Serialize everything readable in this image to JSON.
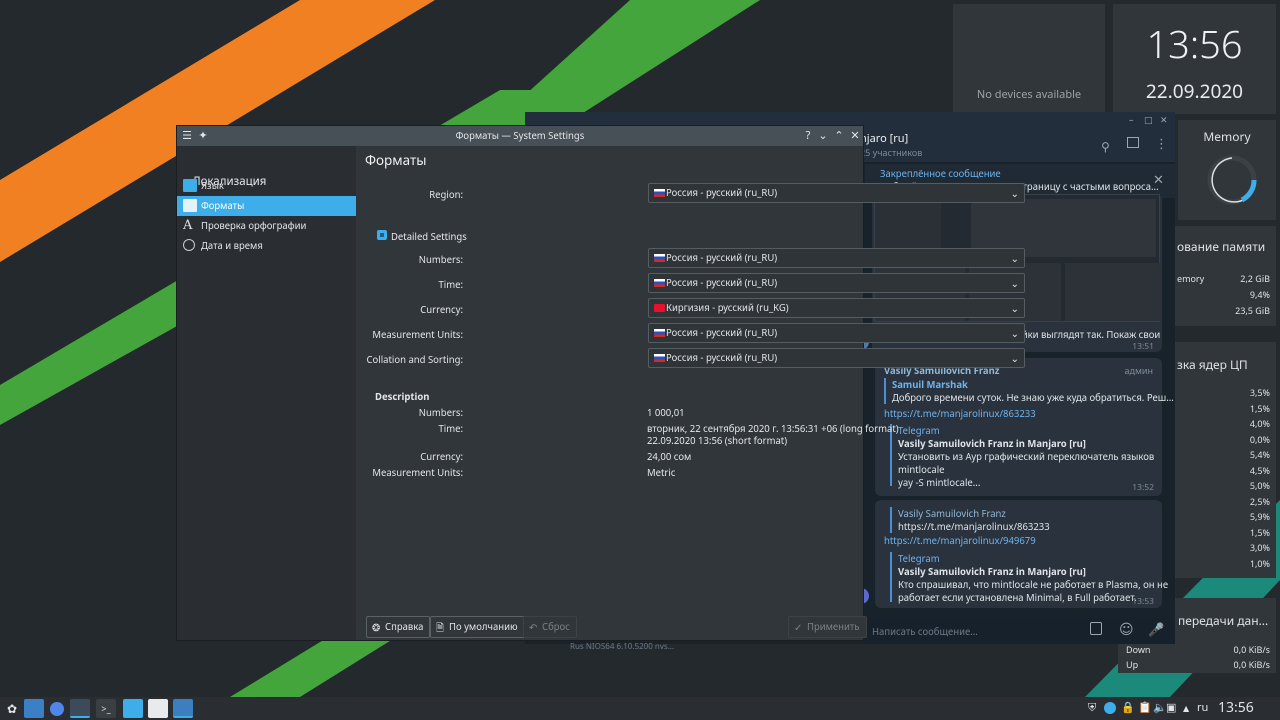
{
  "desktop": {
    "devices_text": "No devices available",
    "clock_time": "13:56",
    "clock_date": "22.09.2020",
    "memory_title": "Memory",
    "usage_title": "ование памяти",
    "usage_rows": [
      {
        "label": "emory",
        "value": "2,2 GiB"
      },
      {
        "label": "",
        "value": "9,4%"
      },
      {
        "label": "",
        "value": "23,5 GiB"
      }
    ],
    "cpu_title": "зка ядер ЦП",
    "cpu_values": [
      "3,5%",
      "1,5%",
      "4,0%",
      "0,0%",
      "5,4%",
      "4,5%",
      "5,0%",
      "2,5%",
      "5,9%",
      "1,5%",
      "3,0%",
      "1,0%"
    ],
    "net_title": "передачи дан...",
    "net_rows": [
      {
        "label": "Down",
        "value": "0,0 KiB/s"
      },
      {
        "label": "Up",
        "value": "0,0 KiB/s"
      }
    ],
    "behind_text": "Rus NIOS64 6.10.5200 nvs..."
  },
  "telegram": {
    "chat_title": "njaro [ru]",
    "members": "25 участников",
    "pinned_label": "Закреплённое сообщение",
    "pinned_text": "Добрый день, Решил создать страницу с частыми вопроса...",
    "msg1_text": "у меня англ в системе. Настройки выглядят так. Покаж свои",
    "msg1_time": "13:51",
    "msg2": {
      "author": "Vasily Samuilovich Franz",
      "role": "админ",
      "reply_author": "Samuil Marshak",
      "reply_text": "Доброго времени суток. Не знаю уже куда обратиться. Реш...",
      "link": "https://t.me/manjarolinux/863233",
      "fwd_source": "Telegram",
      "fwd_title": "Vasily Samuilovich Franz in Manjaro [ru]",
      "fwd_lines": [
        "Установить из Аур графический переключатель языков",
        "mintlocale",
        "yay -S mintlocale..."
      ],
      "time": "13:52"
    },
    "msg3": {
      "reply_author": "Vasily Samuilovich Franz",
      "reply_text": "https://t.me/manjarolinux/863233",
      "link": "https://t.me/manjarolinux/949679",
      "fwd_source": "Telegram",
      "fwd_title": "Vasily Samuilovich Franz in Manjaro [ru]",
      "fwd_lines": [
        "Кто спрашивал, что mintlocale не работает в Plasma, он не",
        "работает если установлена Minimal, в Full работает."
      ],
      "time": "13:53"
    },
    "input_placeholder": "Написать сообщение..."
  },
  "dialog": {
    "title": "Форматы — System Settings",
    "sidebar": {
      "back_label": "Локализация",
      "items": [
        {
          "label": "Язык"
        },
        {
          "label": "Форматы"
        },
        {
          "label": "Проверка орфографии"
        },
        {
          "label": "Дата и время"
        }
      ]
    },
    "page_title": "Форматы",
    "region_label": "Region:",
    "region_value": "Россия - русский (ru_RU)",
    "detailed_label": "Detailed Settings",
    "fields": [
      {
        "label": "Numbers:",
        "value": "Россия - русский (ru_RU)"
      },
      {
        "label": "Time:",
        "value": "Россия - русский (ru_RU)"
      },
      {
        "label": "Currency:",
        "value": "Киргизия - русский (ru_KG)"
      },
      {
        "label": "Measurement Units:",
        "value": "Россия - русский (ru_RU)"
      },
      {
        "label": "Collation and Sorting:",
        "value": "Россия - русский (ru_RU)"
      }
    ],
    "description": {
      "heading": "Description",
      "numbers_label": "Numbers:",
      "numbers_value": "1 000,01",
      "time_label": "Time:",
      "time_long": "вторник, 22 сентября 2020 г. 13:56:31 +06 (long format)",
      "time_short": "22.09.2020 13:56 (short format)",
      "currency_label": "Currency:",
      "currency_value": "24,00 сом",
      "units_label": "Measurement Units:",
      "units_value": "Metric"
    },
    "buttons": {
      "help": "Справка",
      "defaults": "По умолчанию",
      "reset": "Сброс",
      "apply": "Применить"
    }
  },
  "taskbar": {
    "lang": "ru",
    "time": "13:56"
  },
  "colors": {
    "accent": "#3daee9",
    "stripe_orange": "#f08022",
    "stripe_green": "#43a53b",
    "window_bg": "#31363b"
  }
}
